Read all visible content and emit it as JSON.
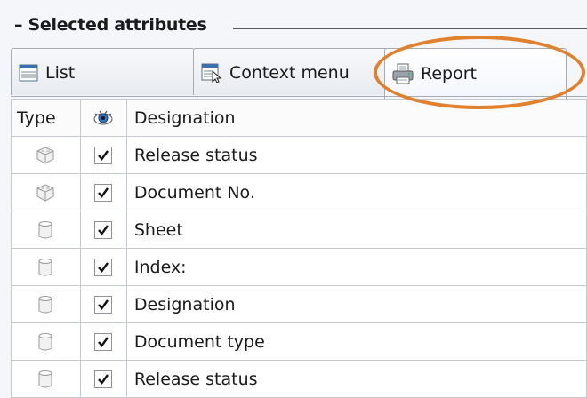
{
  "group": {
    "title": "– Selected attributes"
  },
  "tabs": [
    {
      "label": "List",
      "icon": "list-icon"
    },
    {
      "label": "Context menu",
      "icon": "context-menu-icon"
    },
    {
      "label": "Report",
      "icon": "report-icon",
      "active": true
    }
  ],
  "table": {
    "headers": {
      "type": "Type",
      "visible_icon": "eye-icon",
      "designation": "Designation"
    },
    "rows": [
      {
        "type_icon": "object-attribute-icon",
        "visible": true,
        "designation": "Release status"
      },
      {
        "type_icon": "object-attribute-icon",
        "visible": true,
        "designation": "Document No."
      },
      {
        "type_icon": "database-attribute-icon",
        "visible": true,
        "designation": "Sheet"
      },
      {
        "type_icon": "database-attribute-icon",
        "visible": true,
        "designation": "Index:"
      },
      {
        "type_icon": "database-attribute-icon",
        "visible": true,
        "designation": "Designation"
      },
      {
        "type_icon": "database-attribute-icon",
        "visible": true,
        "designation": "Document type"
      },
      {
        "type_icon": "database-attribute-icon",
        "visible": true,
        "designation": "Release status"
      }
    ]
  },
  "colors": {
    "highlight": "#e1802d",
    "grid_border": "#c6c9ce",
    "tab_border": "#a7abb2"
  }
}
